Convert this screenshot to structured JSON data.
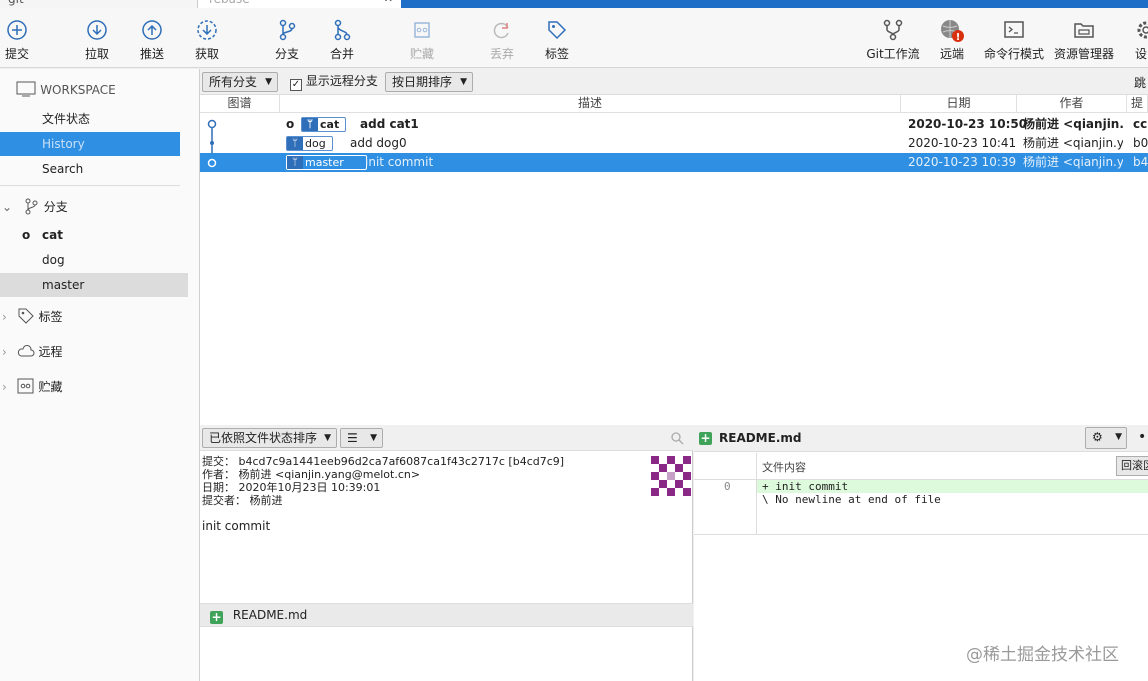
{
  "tabs": {
    "tab1": "git",
    "tab2": "rebase",
    "close": "✕"
  },
  "toolbar": {
    "commit": "提交",
    "pull": "拉取",
    "push": "推送",
    "fetch": "获取",
    "branch": "分支",
    "merge": "合并",
    "stash": "贮藏",
    "discard": "丢弃",
    "tag": "标签",
    "gitflow": "Git工作流",
    "remote": "远端",
    "terminal": "命令行模式",
    "explorer": "资源管理器",
    "settings": "设"
  },
  "sidebar": {
    "workspace": "WORKSPACE",
    "file_status": "文件状态",
    "history": "History",
    "search": "Search",
    "branches": "分支",
    "branch_items": [
      "cat",
      "dog",
      "master"
    ],
    "tags": "标签",
    "remotes": "远程",
    "stashes": "贮藏"
  },
  "filter": {
    "all_branches": "所有分支",
    "show_remote": "显示远程分支",
    "sort": "按日期排序",
    "jump": "跳"
  },
  "columns": {
    "graph": "图谱",
    "desc": "描述",
    "date": "日期",
    "author": "作者",
    "hash": "提"
  },
  "commits": [
    {
      "branch": "cat",
      "message": "add cat1",
      "date": "2020-10-23 10:50",
      "author": "杨前进 <qianjin.y",
      "hash": "cc"
    },
    {
      "branch": "dog",
      "message": "add dog0",
      "date": "2020-10-23 10:41",
      "author": "杨前进 <qianjin.ya",
      "hash": "b0"
    },
    {
      "branch": "master",
      "message": "init commit",
      "date": "2020-10-23 10:39",
      "author": "杨前进 <qianjin.ya",
      "hash": "b4"
    }
  ],
  "lower_left": {
    "sort_by_status": "已依照文件状态排序",
    "commit_line": "提交： b4cd7c9a1441eeb96d2ca7af6087ca1f43c2717c [b4cd7c9]",
    "author_line": "作者： 杨前进 <qianjin.yang@melot.cn>",
    "date_line": "日期： 2020年10月23日 10:39:01",
    "committer_line": "提交者： 杨前进",
    "message": "init commit",
    "file": "README.md"
  },
  "lower_right": {
    "file": "README.md",
    "file_content_label": "文件内容",
    "scroll_btn": "回滚区",
    "line_num": "0",
    "diff_line1": "+ init commit",
    "diff_line2": "\\  No newline at end of file"
  },
  "watermark": "@稀土掘金技术社区"
}
